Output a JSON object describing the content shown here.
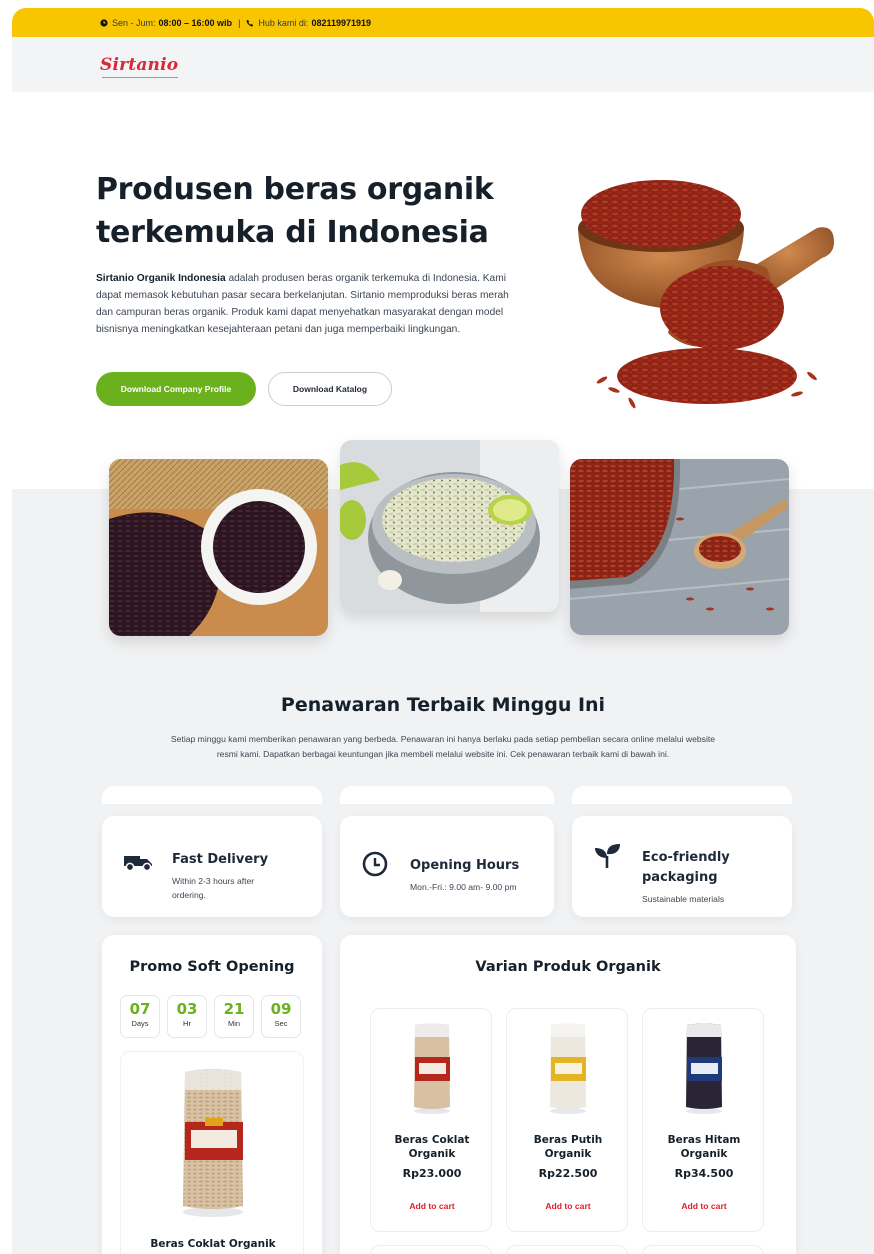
{
  "topbar": {
    "hours_label": "Sen - Jum:",
    "hours_value": "08:00 – 16:00 wib",
    "separator": "|",
    "contact_label": "Hub kami di:",
    "contact_value": "082119971919"
  },
  "nav": {
    "logo": "Sirtanio"
  },
  "hero": {
    "title_line1": "Produsen beras organik",
    "title_line2": "terkemuka di Indonesia",
    "desc_bold": "Sirtanio Organik Indonesia",
    "desc_rest": " adalah produsen beras organik terkemuka di Indonesia. Kami dapat memasok kebutuhan pasar secara berkelanjutan. Sirtanio memproduksi beras merah dan campuran beras organik. Produk kami dapat menyehatkan masyarakat dengan model bisnisnya meningkatkan kesejahteraan petani dan juga memperbaiki lingkungan.",
    "btn_primary": "Download Company Profile",
    "btn_secondary": "Download Katalog"
  },
  "offers": {
    "title": "Penawaran Terbaik Minggu Ini",
    "desc": "Setiap minggu kami memberikan penawaran yang berbeda. Penawaran ini hanya berlaku pada setiap pembelian secara online melalui website resmi kami. Dapatkan berbagai keuntungan jika membeli melalui website ini. Cek penawaran terbaik kami di bawah ini."
  },
  "features": [
    {
      "icon": "truck-icon",
      "title": "Fast Delivery",
      "sub": "Within 2-3 hours after ordering."
    },
    {
      "icon": "clock-icon",
      "title": "Opening Hours",
      "sub": "Mon.-Fri.: 9.00 am- 9.00 pm"
    },
    {
      "icon": "sprout-icon",
      "title": "Eco-friendly packaging",
      "sub": "Sustainable materials"
    }
  ],
  "promo": {
    "title": "Promo Soft Opening",
    "countdown": [
      {
        "value": "07",
        "unit": "Days"
      },
      {
        "value": "03",
        "unit": "Hr"
      },
      {
        "value": "21",
        "unit": "Min"
      },
      {
        "value": "09",
        "unit": "Sec"
      }
    ],
    "product_name": "Beras Coklat Organik"
  },
  "products": {
    "title": "Varian Produk Organik",
    "items": [
      {
        "name": "Beras Coklat Organik",
        "price": "Rp23.000",
        "cta": "Add to cart"
      },
      {
        "name": "Beras Putih Organik",
        "price": "Rp22.500",
        "cta": "Add to cart"
      },
      {
        "name": "Beras Hitam Organik",
        "price": "Rp34.500",
        "cta": "Add to cart"
      }
    ]
  },
  "colors": {
    "topbar": "#f7c600",
    "accent_green": "#6bb11e",
    "logo_red": "#d62839",
    "cta_red": "#e11d2a",
    "section_bg": "#f1f2f3"
  }
}
